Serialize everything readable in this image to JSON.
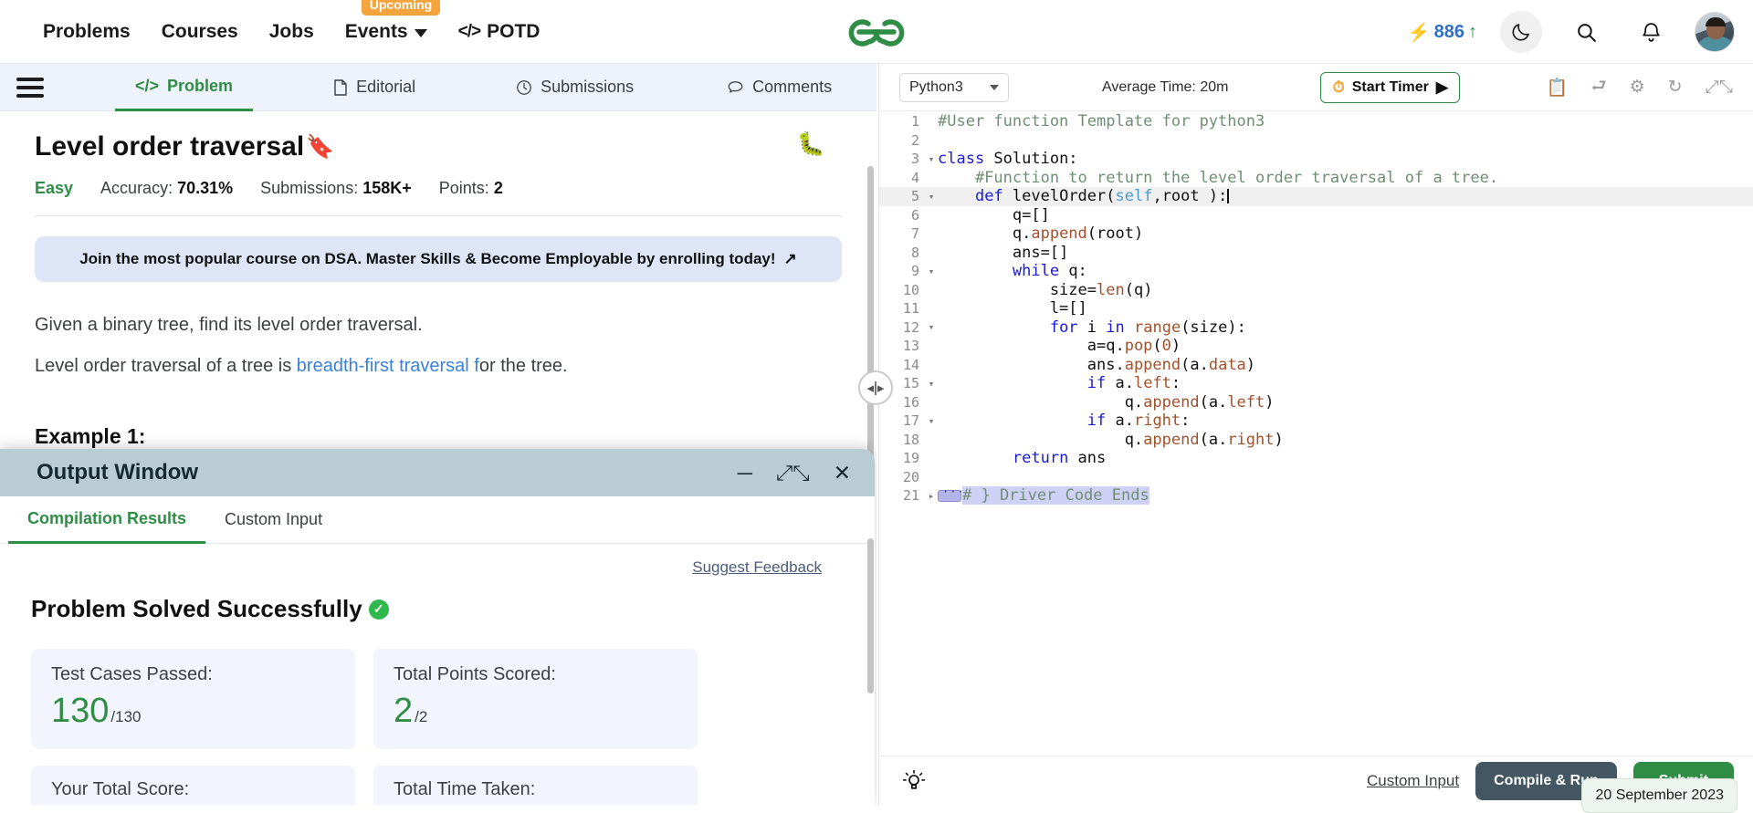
{
  "header": {
    "nav": [
      {
        "label": "Problems",
        "icon": ""
      },
      {
        "label": "Courses",
        "icon": ""
      },
      {
        "label": "Jobs",
        "icon": ""
      },
      {
        "label": "Events",
        "icon": "chevron-down-icon",
        "badge": "Upcoming"
      },
      {
        "label": "POTD",
        "icon": "code-icon"
      }
    ],
    "events_badge": "Upcoming",
    "potd_icon_glyph": "</>",
    "logo_alt": "geeksforgeeks-logo",
    "streak": {
      "count": "886",
      "bolt_glyph": "⚡",
      "arrow_glyph": "↑"
    },
    "theme_toggle_icon": "moon-icon",
    "search_icon": "search-icon",
    "notification_icon": "bell-icon",
    "avatar": "user-avatar"
  },
  "tabs": [
    {
      "label": "Problem",
      "icon": "code-icon",
      "active": true
    },
    {
      "label": "Editorial",
      "icon": "document-icon",
      "active": false
    },
    {
      "label": "Submissions",
      "icon": "clock-icon",
      "active": false
    },
    {
      "label": "Comments",
      "icon": "comment-icon",
      "active": false
    }
  ],
  "problem": {
    "title": "Level order traversal",
    "bookmark_icon": "bookmark-icon",
    "bug_icon": "bug-icon",
    "difficulty": "Easy",
    "accuracy_label": "Accuracy:",
    "accuracy_value": "70.31%",
    "submissions_label": "Submissions:",
    "submissions_value": "158K+",
    "points_label": "Points:",
    "points_value": "2",
    "promo_text": "Join the most popular course on DSA. Master Skills & Become Employable by enrolling today!",
    "promo_icon": "external-link-icon",
    "desc_line1": "Given a binary tree, find its level order traversal.",
    "desc_line2_pre": "Level order traversal of a tree is ",
    "desc_link": "breadth-first traversal f",
    "desc_line2_post": "or the tree.",
    "example_heading": "Example 1:"
  },
  "output_window": {
    "title": "Output Window",
    "minimize_icon": "minimize-icon",
    "expand_icon": "expand-icon",
    "close_icon": "close-icon",
    "tabs": [
      {
        "label": "Compilation Results",
        "active": true
      },
      {
        "label": "Custom Input",
        "active": false
      }
    ],
    "suggest_feedback": "Suggest Feedback",
    "status_text": "Problem Solved Successfully",
    "status_icon": "check-circle-icon",
    "cards": [
      {
        "label": "Test Cases Passed:",
        "value": "130",
        "total": "/130"
      },
      {
        "label": "Total Points Scored:",
        "value": "2",
        "total": "/2"
      }
    ],
    "cards2": [
      {
        "label": "Your Total Score:"
      },
      {
        "label": "Total Time Taken:"
      }
    ]
  },
  "splitter": {
    "icon": "resize-handle-icon"
  },
  "editor": {
    "language": "Python3",
    "average_time": "Average Time: 20m",
    "timer_button": "Start Timer",
    "timer_icon": "stopwatch-icon",
    "play_icon": "play-circle-icon",
    "toolbar_icons": [
      "copy-icon",
      "upload-icon",
      "gear-icon",
      "reset-icon",
      "fullscreen-icon"
    ],
    "code_lines": [
      {
        "n": "1",
        "fold": "",
        "text": "#User function Template for python3",
        "cls": "c-comment"
      },
      {
        "n": "2",
        "fold": "",
        "text": "",
        "cls": ""
      },
      {
        "n": "3",
        "fold": "▾",
        "text": "class Solution:",
        "cls": "kw-class"
      },
      {
        "n": "4",
        "fold": "",
        "text": "    #Function to return the level order traversal of a tree.",
        "cls": "c-comment"
      },
      {
        "n": "5",
        "fold": "▾",
        "text": "    def levelOrder(self,root ):",
        "cls": "def-line",
        "highlight": true
      },
      {
        "n": "6",
        "fold": "",
        "text": "        q=[]",
        "cls": ""
      },
      {
        "n": "7",
        "fold": "",
        "text": "        q.append(root)",
        "cls": "call"
      },
      {
        "n": "8",
        "fold": "",
        "text": "        ans=[]",
        "cls": ""
      },
      {
        "n": "9",
        "fold": "▾",
        "text": "        while q:",
        "cls": "kw-while"
      },
      {
        "n": "10",
        "fold": "",
        "text": "            size=len(q)",
        "cls": "call-len"
      },
      {
        "n": "11",
        "fold": "",
        "text": "            l=[]",
        "cls": ""
      },
      {
        "n": "12",
        "fold": "▾",
        "text": "            for i in range(size):",
        "cls": "kw-for"
      },
      {
        "n": "13",
        "fold": "",
        "text": "                a=q.pop(0)",
        "cls": "call-pop"
      },
      {
        "n": "14",
        "fold": "",
        "text": "                ans.append(a.data)",
        "cls": "call-append"
      },
      {
        "n": "15",
        "fold": "▾",
        "text": "                if a.left:",
        "cls": "kw-if-left"
      },
      {
        "n": "16",
        "fold": "",
        "text": "                    q.append(a.left)",
        "cls": "call-append2"
      },
      {
        "n": "17",
        "fold": "▾",
        "text": "                if a.right:",
        "cls": "kw-if-right"
      },
      {
        "n": "18",
        "fold": "",
        "text": "                    q.append(a.right)",
        "cls": "call-append3"
      },
      {
        "n": "19",
        "fold": "",
        "text": "        return ans",
        "cls": "kw-return"
      },
      {
        "n": "20",
        "fold": "",
        "text": "",
        "cls": ""
      },
      {
        "n": "21",
        "fold": "▸",
        "text": "# } Driver Code Ends",
        "cls": "folded"
      }
    ],
    "bulb_icon": "lightbulb-icon",
    "custom_input_link": "Custom Input",
    "compile_run_button": "Compile & Run",
    "submit_button": "Submit",
    "date_tooltip": "20 September 2023"
  }
}
